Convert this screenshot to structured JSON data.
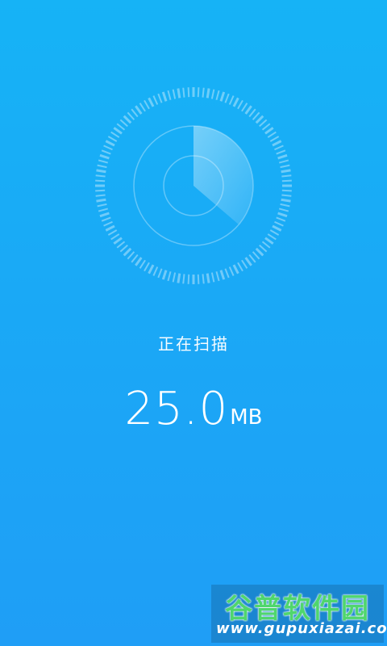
{
  "scan": {
    "status_label": "正在扫描",
    "size_value": "25.0",
    "size_unit": "MB"
  },
  "watermark": {
    "name_cn": "谷普软件园",
    "url": "www.gupuxiazai.com"
  },
  "radar": {
    "icon": "radar-scan-icon"
  },
  "colors": {
    "background_top": "#16b3f6",
    "background_bottom": "#1f9ef6",
    "watermark_green": "#4fd66d"
  }
}
